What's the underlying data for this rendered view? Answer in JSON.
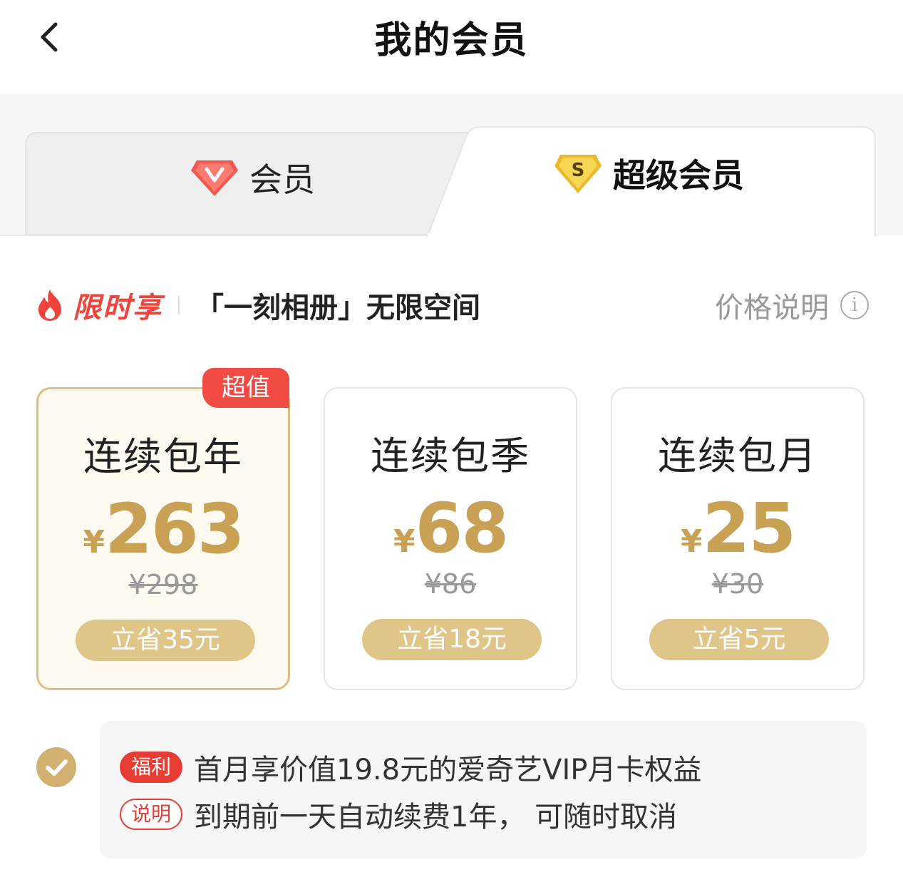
{
  "header": {
    "title": "我的会员",
    "back_icon": "chevron-left-icon"
  },
  "tabs": [
    {
      "label": "会员",
      "icon": "red-diamond-v-icon",
      "active": false
    },
    {
      "label": "超级会员",
      "icon": "gold-diamond-s-icon",
      "active": true
    }
  ],
  "promo": {
    "tag": "限时享",
    "text": "「一刻相册」无限空间",
    "price_desc": "价格说明",
    "info_glyph": "i"
  },
  "plans": [
    {
      "name": "连续包年",
      "currency": "¥",
      "price": "263",
      "original": "¥298",
      "save": "立省35元",
      "badge": "超值",
      "selected": true
    },
    {
      "name": "连续包季",
      "currency": "¥",
      "price": "68",
      "original": "¥86",
      "save": "立省18元",
      "selected": false
    },
    {
      "name": "连续包月",
      "currency": "¥",
      "price": "25",
      "original": "¥30",
      "save": "立省5元",
      "selected": false
    }
  ],
  "benefit": {
    "tag1": "福利",
    "line1": "首月享价值19.8元的爱奇艺VIP月卡权益",
    "tag2": "说明",
    "line2": "到期前一天自动续费1年， 可随时取消"
  },
  "colors": {
    "gold": "#c9a155",
    "gold_button": "#e0c589",
    "red": "#e73d34",
    "selected_bg": "#fffaf0"
  }
}
